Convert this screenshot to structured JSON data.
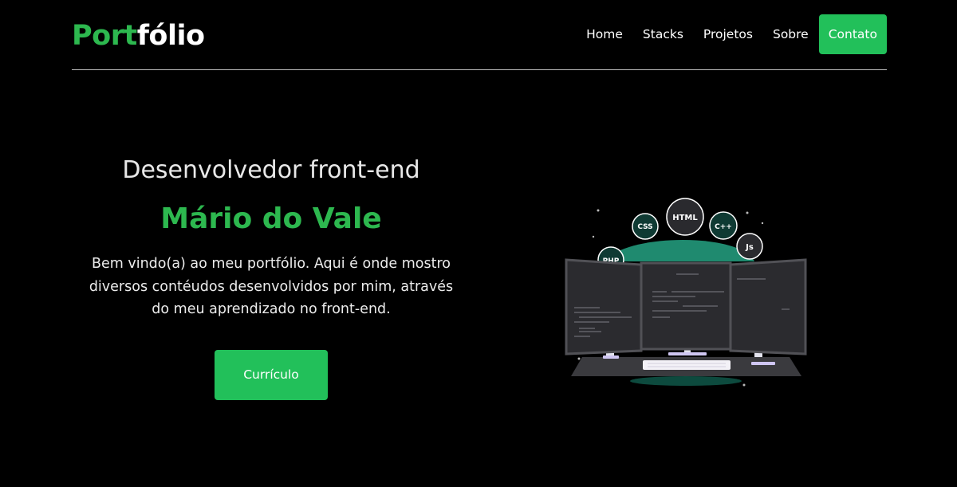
{
  "header": {
    "logo_green": "Port",
    "logo_white": "fólio",
    "nav": [
      "Home",
      "Stacks",
      "Projetos",
      "Sobre"
    ],
    "contact_label": "Contato"
  },
  "hero": {
    "role": "Desenvolvedor front-end",
    "name": "Mário do Vale",
    "description": "Bem vindo(a) ao meu portfólio. Aqui é onde mostro diversos contéudos desenvolvidos por mim, através do meu aprendizado no front-end.",
    "cv_label": "Currículo"
  },
  "illustration": {
    "badges": [
      "HTML",
      "CSS",
      "C++",
      "Js",
      "PHP"
    ]
  },
  "colors": {
    "accent": "#22c05a",
    "logo_green": "#2db84f",
    "background": "#000000",
    "teal": "#1f8a6f"
  }
}
